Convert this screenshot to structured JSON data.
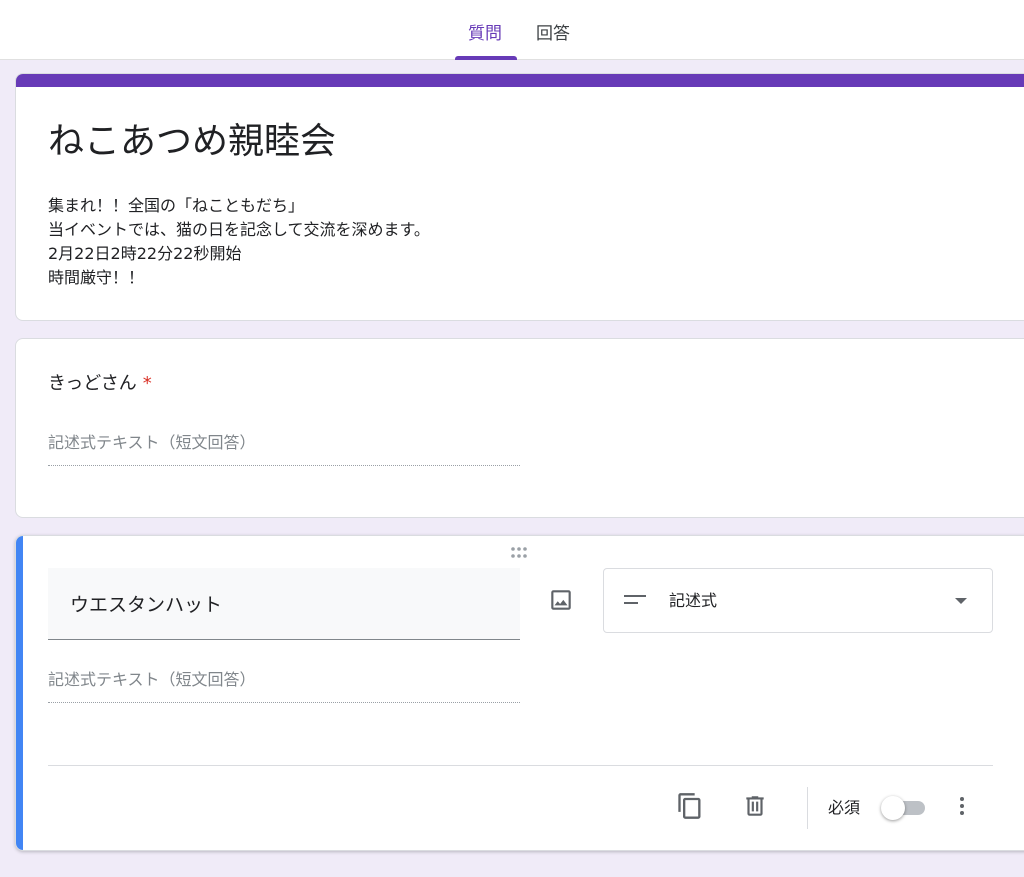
{
  "tabs": [
    {
      "label": "質問",
      "active": true
    },
    {
      "label": "回答",
      "active": false
    }
  ],
  "form": {
    "title": "ねこあつめ親睦会",
    "description_lines": [
      "集まれ！！全国の「ねこともだち」",
      "当イベントでは、猫の日を記念して交流を深めます。",
      "2月22日2時22分22秒開始",
      "時間厳守！！"
    ],
    "accent_color": "#673ab7"
  },
  "question1": {
    "title": "きっどさん",
    "required_mark": "*",
    "answer_placeholder": "記述式テキスト（短文回答）"
  },
  "question2": {
    "title_value": "ウエスタンハット",
    "type_label": "記述式",
    "answer_placeholder": "記述式テキスト（短文回答）",
    "required_label": "必須",
    "required_on": false,
    "accent_color": "#4285f4"
  },
  "icons": {
    "drag": "drag-handle-icon",
    "image": "image-icon",
    "short_text": "short-text-icon",
    "dropdown": "dropdown-arrow-icon",
    "duplicate": "copy-icon",
    "delete": "trash-icon",
    "more": "more-vert-icon"
  }
}
